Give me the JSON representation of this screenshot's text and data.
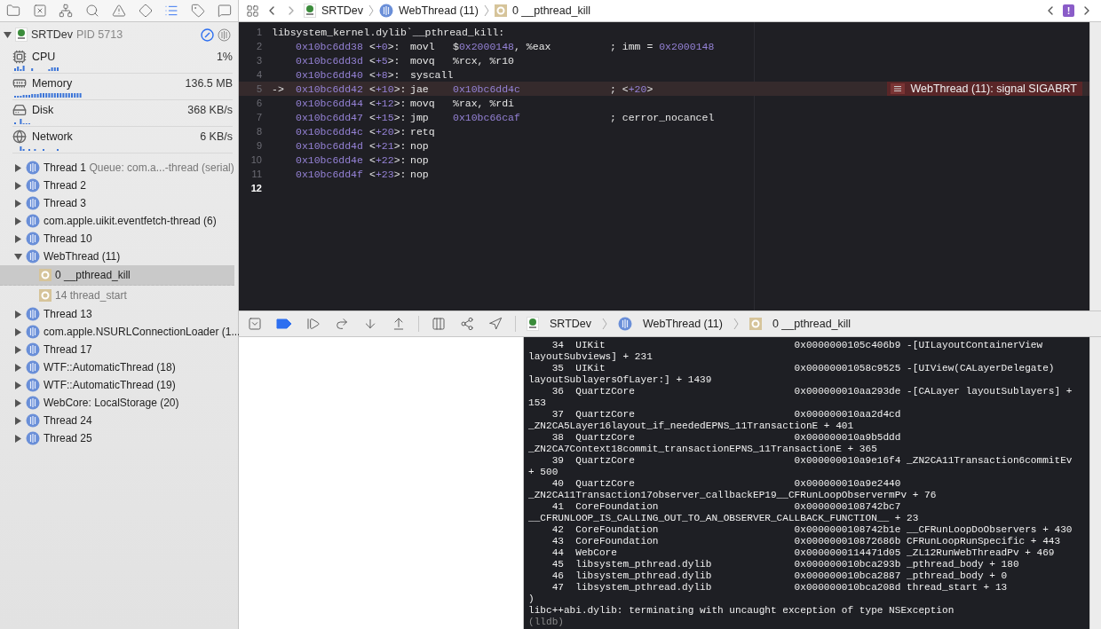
{
  "navigator": {
    "tabs": [
      {
        "selected": false
      },
      {
        "selected": false
      },
      {
        "selected": false
      },
      {
        "selected": false
      },
      {
        "selected": false
      },
      {
        "selected": false
      },
      {
        "selected": true
      },
      {
        "selected": false
      },
      {
        "selected": false
      }
    ]
  },
  "jump_bar": {
    "items": [
      {
        "kind": "app",
        "label": "SRTDev"
      },
      {
        "kind": "thread",
        "label": "WebThread (11)"
      },
      {
        "kind": "frame",
        "label": "0 __pthread_kill"
      }
    ],
    "issue_badge": "!"
  },
  "process": {
    "name": "SRTDev",
    "pid": "PID 5713"
  },
  "gauges": [
    {
      "kind": "cpu",
      "label": "CPU",
      "value": "1%"
    },
    {
      "kind": "memory",
      "label": "Memory",
      "value": "136.5 MB"
    },
    {
      "kind": "disk",
      "label": "Disk",
      "value": "368 KB/s"
    },
    {
      "kind": "network",
      "label": "Network",
      "value": "6 KB/s"
    }
  ],
  "threads": [
    {
      "label": "Thread 1",
      "queue": "Queue: com.a...-thread (serial)",
      "expanded": false,
      "selected": false
    },
    {
      "label": "Thread 2",
      "expanded": false,
      "selected": false
    },
    {
      "label": "Thread 3",
      "expanded": false,
      "selected": false
    },
    {
      "label": "com.apple.uikit.eventfetch-thread (6)",
      "expanded": false,
      "selected": false
    },
    {
      "label": "Thread 10",
      "expanded": false,
      "selected": false
    },
    {
      "label": "WebThread (11)",
      "expanded": true,
      "selected": false,
      "children": [
        {
          "label": "0 __pthread_kill",
          "selected": true,
          "dimmed": false
        },
        {
          "label": "14 thread_start",
          "selected": false,
          "dimmed": true
        }
      ]
    },
    {
      "label": "Thread 13",
      "expanded": false,
      "selected": false
    },
    {
      "label": "com.apple.NSURLConnectionLoader (1...",
      "expanded": false,
      "selected": false
    },
    {
      "label": "Thread 17",
      "expanded": false,
      "selected": false
    },
    {
      "label": "WTF::AutomaticThread (18)",
      "expanded": false,
      "selected": false
    },
    {
      "label": "WTF::AutomaticThread (19)",
      "expanded": false,
      "selected": false
    },
    {
      "label": "WebCore: LocalStorage (20)",
      "expanded": false,
      "selected": false
    },
    {
      "label": "Thread 24",
      "expanded": false,
      "selected": false
    },
    {
      "label": "Thread 25",
      "expanded": false,
      "selected": false
    }
  ],
  "editor": {
    "lines": [
      {
        "no": "1",
        "kind": "label",
        "text": "libsystem_kernel.dylib`__pthread_kill:",
        "current": false,
        "cursor": false
      },
      {
        "no": "2",
        "kind": "instr",
        "addr": "0x10bc6dd38",
        "offset": [
          {
            "t": "<"
          },
          {
            "t": "+0",
            "num": true
          },
          {
            "t": ">:"
          }
        ],
        "op": "movl",
        "args": [
          {
            "t": "$"
          },
          {
            "t": "0x2000148",
            "num": true
          },
          {
            "t": ", %eax"
          }
        ],
        "comment": [
          {
            "t": "; imm = "
          },
          {
            "t": "0x2000148",
            "num": true
          }
        ],
        "current": false,
        "cursor": false
      },
      {
        "no": "3",
        "kind": "instr",
        "addr": "0x10bc6dd3d",
        "offset": [
          {
            "t": "<"
          },
          {
            "t": "+5",
            "num": true
          },
          {
            "t": ">:"
          }
        ],
        "op": "movq",
        "args": [
          {
            "t": "%rcx, %r10"
          }
        ],
        "current": false,
        "cursor": false
      },
      {
        "no": "4",
        "kind": "instr",
        "addr": "0x10bc6dd40",
        "offset": [
          {
            "t": "<"
          },
          {
            "t": "+8",
            "num": true
          },
          {
            "t": ">:"
          }
        ],
        "op": "syscall",
        "current": false,
        "cursor": false
      },
      {
        "no": "5",
        "kind": "instr",
        "marker": "->",
        "addr": "0x10bc6dd42",
        "offset": [
          {
            "t": "<"
          },
          {
            "t": "+10",
            "num": true
          },
          {
            "t": ">:"
          }
        ],
        "op": "jae",
        "args": [
          {
            "t": "0x10bc6dd4c",
            "num": true
          }
        ],
        "comment": [
          {
            "t": "; <"
          },
          {
            "t": "+20",
            "num": true
          },
          {
            "t": ">"
          }
        ],
        "current": true,
        "cursor": false,
        "annotation": "WebThread (11): signal SIGABRT"
      },
      {
        "no": "6",
        "kind": "instr",
        "addr": "0x10bc6dd44",
        "offset": [
          {
            "t": "<"
          },
          {
            "t": "+12",
            "num": true
          },
          {
            "t": ">:"
          }
        ],
        "op": "movq",
        "args": [
          {
            "t": "%rax, %rdi"
          }
        ],
        "current": false,
        "cursor": false
      },
      {
        "no": "7",
        "kind": "instr",
        "addr": "0x10bc6dd47",
        "offset": [
          {
            "t": "<"
          },
          {
            "t": "+15",
            "num": true
          },
          {
            "t": ">:"
          }
        ],
        "op": "jmp",
        "args": [
          {
            "t": "0x10bc66caf",
            "num": true
          }
        ],
        "comment": [
          {
            "t": "; cerror_nocancel"
          }
        ],
        "current": false,
        "cursor": false
      },
      {
        "no": "8",
        "kind": "instr",
        "addr": "0x10bc6dd4c",
        "offset": [
          {
            "t": "<"
          },
          {
            "t": "+20",
            "num": true
          },
          {
            "t": ">:"
          }
        ],
        "op": "retq",
        "current": false,
        "cursor": false
      },
      {
        "no": "9",
        "kind": "instr",
        "addr": "0x10bc6dd4d",
        "offset": [
          {
            "t": "<"
          },
          {
            "t": "+21",
            "num": true
          },
          {
            "t": ">:"
          }
        ],
        "op": "nop",
        "current": false,
        "cursor": false
      },
      {
        "no": "10",
        "kind": "instr",
        "addr": "0x10bc6dd4e",
        "offset": [
          {
            "t": "<"
          },
          {
            "t": "+22",
            "num": true
          },
          {
            "t": ">:"
          }
        ],
        "op": "nop",
        "current": false,
        "cursor": false
      },
      {
        "no": "11",
        "kind": "instr",
        "addr": "0x10bc6dd4f",
        "offset": [
          {
            "t": "<"
          },
          {
            "t": "+23",
            "num": true
          },
          {
            "t": ">:"
          }
        ],
        "op": "nop",
        "current": false,
        "cursor": false
      },
      {
        "no": "12",
        "kind": "empty",
        "current": false,
        "cursor": true
      }
    ]
  },
  "debug_bar": {
    "breakpoints_active": true,
    "jump_bar": [
      {
        "kind": "app",
        "label": "SRTDev"
      },
      {
        "kind": "thread",
        "label": "WebThread (11)"
      },
      {
        "kind": "frame",
        "label": "0 __pthread_kill"
      }
    ]
  },
  "console": {
    "lines": [
      "    34  UIKit                                0x0000000105c406b9 -[UILayoutContainerView",
      "layoutSubviews] + 231",
      "    35  UIKit                                0x00000001058c9525 -[UIView(CALayerDelegate)",
      "layoutSublayersOfLayer:] + 1439",
      "    36  QuartzCore                           0x000000010aa293de -[CALayer layoutSublayers] +",
      "153",
      "    37  QuartzCore                           0x000000010aa2d4cd",
      "_ZN2CA5Layer16layout_if_neededEPNS_11TransactionE + 401",
      "    38  QuartzCore                           0x000000010a9b5ddd",
      "_ZN2CA7Context18commit_transactionEPNS_11TransactionE + 365",
      "    39  QuartzCore                           0x000000010a9e16f4 _ZN2CA11Transaction6commitEv",
      "+ 500",
      "    40  QuartzCore                           0x000000010a9e2440",
      "_ZN2CA11Transaction17observer_callbackEP19__CFRunLoopObservermPv + 76",
      "    41  CoreFoundation                       0x0000000108742bc7",
      "__CFRUNLOOP_IS_CALLING_OUT_TO_AN_OBSERVER_CALLBACK_FUNCTION__ + 23",
      "    42  CoreFoundation                       0x0000000108742b1e __CFRunLoopDoObservers + 430",
      "    43  CoreFoundation                       0x000000010872686b CFRunLoopRunSpecific + 443",
      "    44  WebCore                              0x0000000114471d05 _ZL12RunWebThreadPv + 469",
      "    45  libsystem_pthread.dylib              0x000000010bca293b _pthread_body + 180",
      "    46  libsystem_pthread.dylib              0x000000010bca2887 _pthread_body + 0",
      "    47  libsystem_pthread.dylib              0x000000010bca208d thread_start + 13",
      ")",
      "libc++abi.dylib: terminating with uncaught exception of type NSException"
    ],
    "prompt": "(lldb)"
  }
}
